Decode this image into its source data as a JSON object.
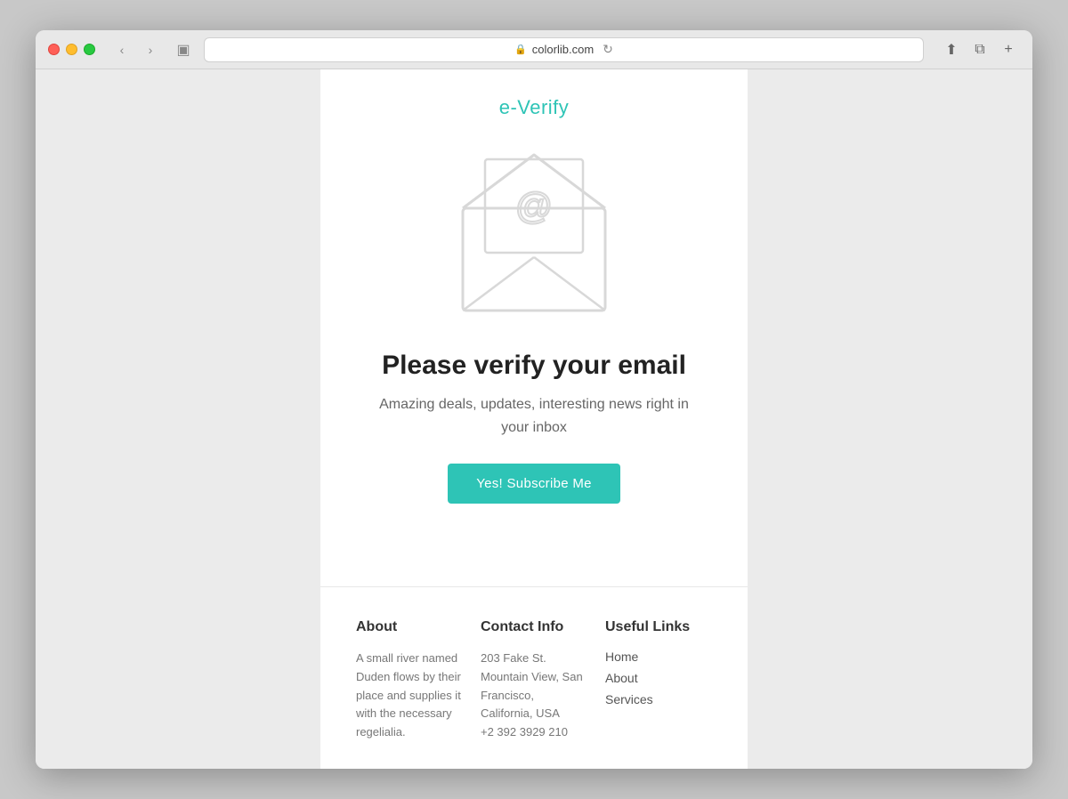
{
  "browser": {
    "url": "colorlib.com",
    "back_label": "‹",
    "forward_label": "›",
    "reader_label": "⊞"
  },
  "logo": "e-Verify",
  "heading": "Please verify your email",
  "subtext_line1": "Amazing deals, updates, interesting news right in",
  "subtext_line2": "your inbox",
  "subscribe_btn": "Yes! Subscribe Me",
  "footer": {
    "about": {
      "title": "About",
      "text": "A small river named Duden flows by their place and supplies it with the necessary regelialia."
    },
    "contact": {
      "title": "Contact Info",
      "address": "203 Fake St. Mountain View, San Francisco, California, USA",
      "phone": "+2 392 3929 210"
    },
    "links": {
      "title": "Useful Links",
      "items": [
        "Home",
        "About",
        "Services"
      ]
    }
  }
}
